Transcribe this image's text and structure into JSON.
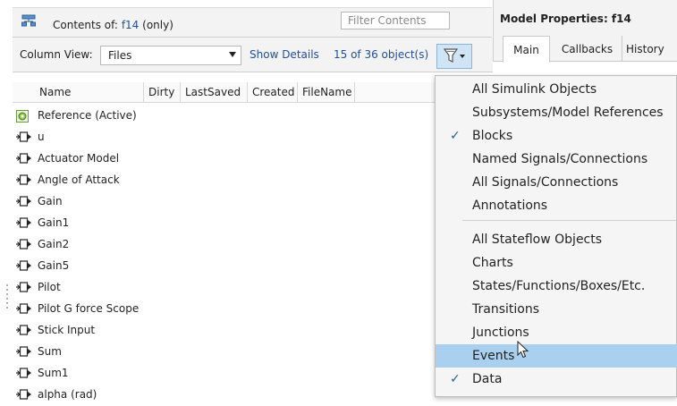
{
  "toolbar": {
    "contents_label": "Contents of:",
    "model_link": "f14",
    "only_text": "(only)",
    "filter_placeholder": "Filter Contents"
  },
  "column_view": {
    "label": "Column View:",
    "selected": "Files",
    "show_details": "Show Details",
    "object_count": "15 of 36 object(s)"
  },
  "table": {
    "columns": [
      "Name",
      "Dirty",
      "LastSaved",
      "Created",
      "FileName"
    ],
    "rows": [
      {
        "name": "Reference (Active)",
        "icon": "model-reference-icon"
      },
      {
        "name": "u",
        "icon": "block-icon"
      },
      {
        "name": "Actuator Model",
        "icon": "block-icon"
      },
      {
        "name": "Angle of  Attack",
        "icon": "block-icon"
      },
      {
        "name": "Gain",
        "icon": "block-icon"
      },
      {
        "name": "Gain1",
        "icon": "block-icon"
      },
      {
        "name": "Gain2",
        "icon": "block-icon"
      },
      {
        "name": "Gain5",
        "icon": "block-icon"
      },
      {
        "name": "Pilot",
        "icon": "block-icon"
      },
      {
        "name": "Pilot G force Scope",
        "icon": "block-icon"
      },
      {
        "name": "Stick Input",
        "icon": "block-icon"
      },
      {
        "name": "Sum",
        "icon": "block-icon"
      },
      {
        "name": "Sum1",
        "icon": "block-icon"
      },
      {
        "name": "alpha (rad)",
        "icon": "block-icon"
      }
    ]
  },
  "properties": {
    "title": "Model Properties: f14",
    "tabs": [
      "Main",
      "Callbacks",
      "History"
    ]
  },
  "filter_menu": {
    "items": [
      {
        "label": "All Simulink Objects",
        "checked": false
      },
      {
        "label": "Subsystems/Model References",
        "checked": false
      },
      {
        "label": "Blocks",
        "checked": true
      },
      {
        "label": "Named Signals/Connections",
        "checked": false
      },
      {
        "label": "All Signals/Connections",
        "checked": false
      },
      {
        "label": "Annotations",
        "checked": false
      },
      {
        "label": "All Stateflow Objects",
        "checked": false
      },
      {
        "label": "Charts",
        "checked": false
      },
      {
        "label": "States/Functions/Boxes/Etc.",
        "checked": false
      },
      {
        "label": "Transitions",
        "checked": false
      },
      {
        "label": "Junctions",
        "checked": false
      },
      {
        "label": "Events",
        "checked": false,
        "highlighted": true
      },
      {
        "label": "Data",
        "checked": true
      }
    ],
    "check_glyph": "✓"
  },
  "colors": {
    "link": "#1f4f9f",
    "menu_highlight": "#a9d0ee",
    "filter_button": "#cfe4f4",
    "check": "#1f5fa8"
  }
}
